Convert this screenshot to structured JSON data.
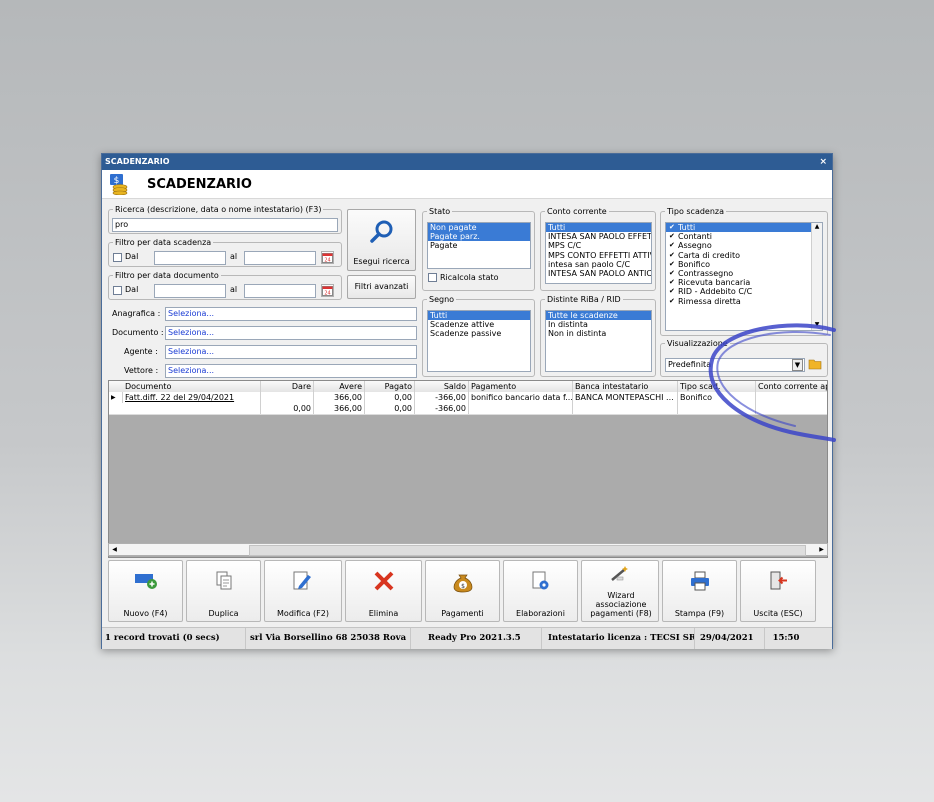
{
  "window": {
    "titlebar": "SCADENZARIO",
    "header_title": "SCADENZARIO",
    "close_glyph": "×"
  },
  "filters": {
    "search_label": "Ricerca (descrizione, data o nome intestatario) (F3)",
    "search_value": "pro",
    "search_button": "Esegui ricerca",
    "due_group": "Filtro per data scadenza",
    "doc_group": "Filtro per data documento",
    "from_label": "Dal",
    "to_label": "al",
    "advanced_button": "Filtri avanzati",
    "anagrafica_label": "Anagrafica :",
    "documento_label": "Documento :",
    "agente_label": "Agente :",
    "vettore_label": "Vettore :",
    "select_placeholder": "Seleziona...",
    "calendar_day": "24"
  },
  "stato": {
    "legend": "Stato",
    "items": [
      "Non pagate",
      "Pagate parz.",
      "Pagate"
    ],
    "recalc_label": "Ricalcola stato"
  },
  "segno": {
    "legend": "Segno",
    "items": [
      "Tutti",
      "Scadenze attive",
      "Scadenze passive"
    ]
  },
  "conto": {
    "legend": "Conto corrente",
    "items": [
      "Tutti",
      "INTESA SAN PAOLO EFFETTI",
      "MPS C/C",
      "MPS CONTO EFFETTI ATTIVI",
      "intesa san paolo C/C",
      "INTESA SAN PAOLO ANTICIPI"
    ]
  },
  "distinte": {
    "legend": "Distinte RiBa / RID",
    "items": [
      "Tutte le scadenze",
      "In distinta",
      "Non in distinta"
    ]
  },
  "tipo": {
    "legend": "Tipo scadenza",
    "items": [
      "Tutti",
      "Contanti",
      "Assegno",
      "Carta di credito",
      "Bonifico",
      "Contrassegno",
      "Ricevuta bancaria",
      "RID - Addebito C/C",
      "Rimessa diretta"
    ]
  },
  "visual": {
    "label": "Visualizzazione",
    "value": "Predefinita"
  },
  "grid": {
    "headers": [
      "Documento",
      "Dare",
      "Avere",
      "Pagato",
      "Saldo",
      "Pagamento",
      "Banca intestatario",
      "Tipo scad.",
      "Conto corrente app"
    ],
    "row": [
      "Fatt.diff. 22 del 29/04/2021",
      "",
      "366,00",
      "0,00",
      "-366,00",
      "bonifico bancario data f...",
      "BANCA MONTEPASCHI ...",
      "Bonifico",
      ""
    ],
    "totals": [
      "",
      "0,00",
      "366,00",
      "0,00",
      "-366,00",
      "",
      "",
      "",
      ""
    ]
  },
  "toolbar": [
    "Nuovo (F4)",
    "Duplica",
    "Modifica (F2)",
    "Elimina",
    "Pagamenti",
    "Elaborazioni",
    "Wizard associazione pagamenti (F8)",
    "Stampa (F9)",
    "Uscita (ESC)"
  ],
  "status": {
    "records": "1 record trovati (0 secs)",
    "company": "srl Via Borsellino 68  25038 Rova",
    "version": "Ready Pro 2021.3.5",
    "license": "Intestatario licenza : TECSI SRL",
    "date": "29/04/2021",
    "time": "15:50"
  },
  "colors": {
    "title_bar": "#2e5c94",
    "selection": "#3a7bd5",
    "link": "#1a3bd4",
    "scribble": "#3b44c8"
  }
}
